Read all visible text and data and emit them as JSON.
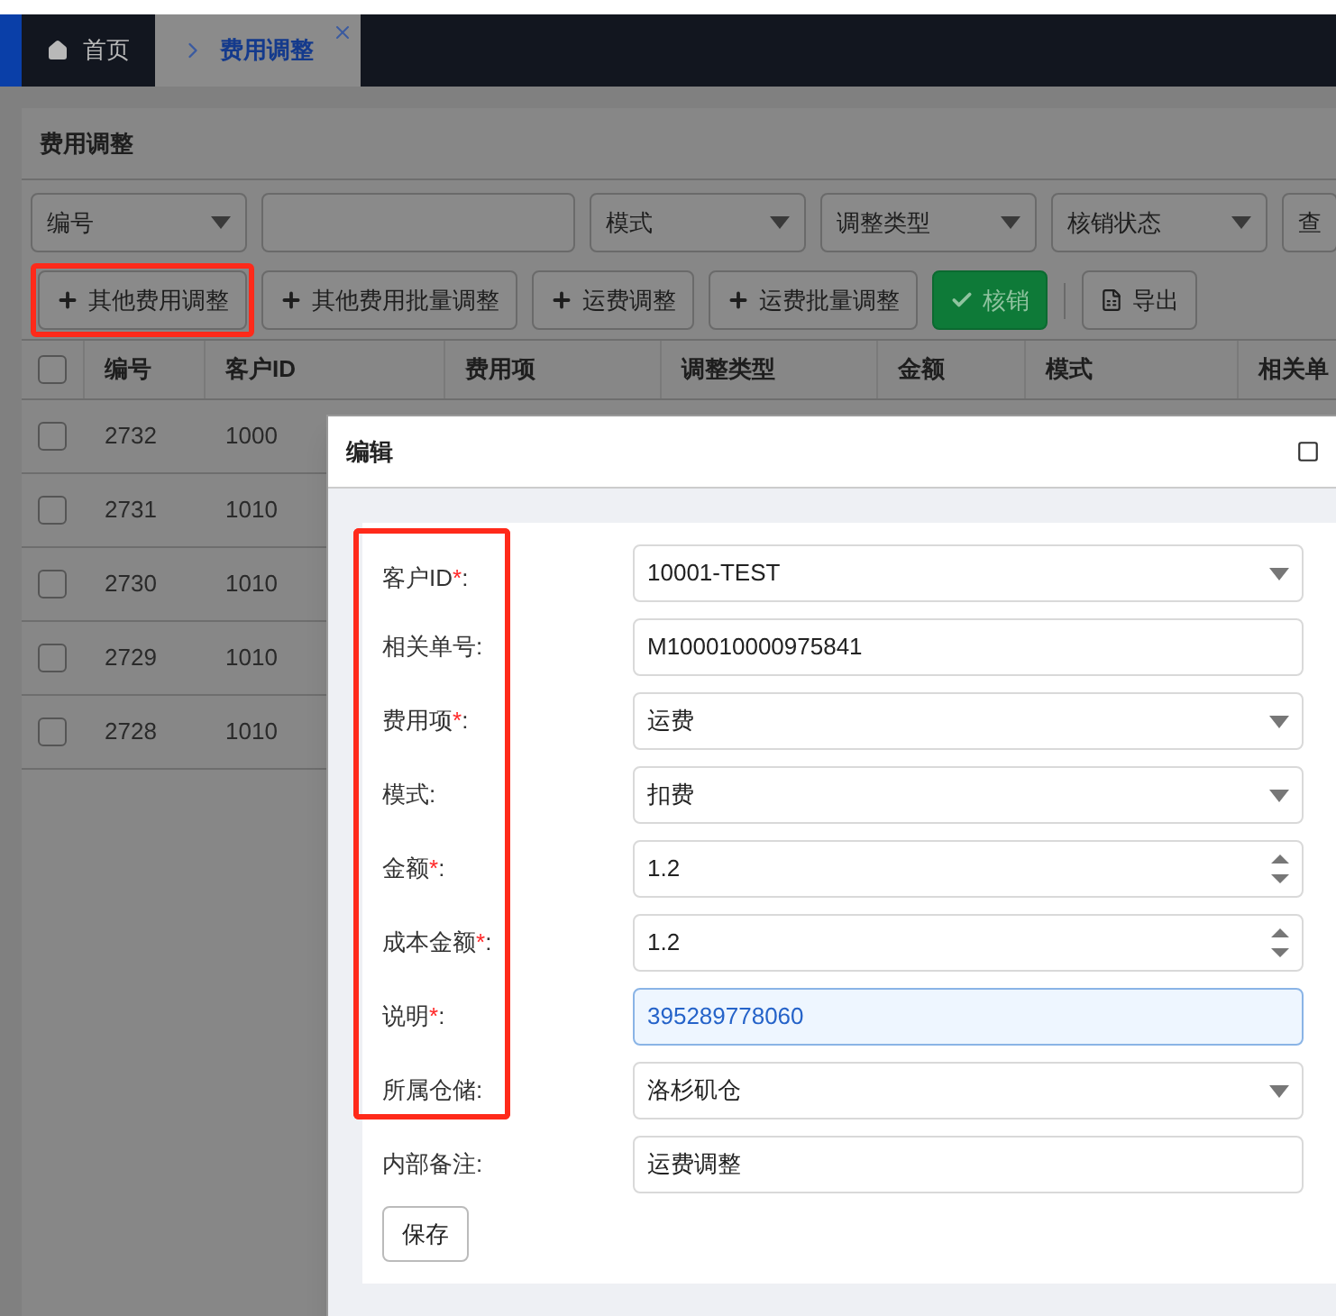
{
  "tabs": [
    {
      "kind": "home",
      "label": "首页",
      "selected": false
    },
    {
      "kind": "page",
      "label": "费用调整",
      "selected": true
    }
  ],
  "panel": {
    "title": "费用调整"
  },
  "filters": [
    {
      "kind": "select",
      "placeholder": "编号"
    },
    {
      "kind": "input"
    },
    {
      "kind": "select",
      "placeholder": "模式"
    },
    {
      "kind": "select",
      "placeholder": "调整类型"
    },
    {
      "kind": "select",
      "placeholder": "核销状态"
    },
    {
      "kind": "button",
      "label": "查"
    }
  ],
  "toolbar": [
    {
      "kind": "add",
      "label": "其他费用调整",
      "highlighted": true
    },
    {
      "kind": "add",
      "label": "其他费用批量调整",
      "highlighted": false
    },
    {
      "kind": "add",
      "label": "运费调整",
      "highlighted": false
    },
    {
      "kind": "add",
      "label": "运费批量调整",
      "highlighted": false
    },
    {
      "kind": "confirm",
      "label": "核销",
      "highlighted": false
    },
    {
      "kind": "separator"
    },
    {
      "kind": "export",
      "label": "导出",
      "highlighted": false
    }
  ],
  "table": {
    "header_checked": false,
    "columns": [
      "编号",
      "客户ID",
      "费用项",
      "调整类型",
      "金额",
      "模式",
      "相关单"
    ],
    "rows": [
      {
        "checked": false,
        "cells": [
          "2732",
          "1000"
        ]
      },
      {
        "checked": false,
        "cells": [
          "2731",
          "1010"
        ]
      },
      {
        "checked": false,
        "cells": [
          "2730",
          "1010"
        ]
      },
      {
        "checked": false,
        "cells": [
          "2729",
          "1010"
        ]
      },
      {
        "checked": false,
        "cells": [
          "2728",
          "1010"
        ]
      }
    ]
  },
  "modal": {
    "title": "编辑",
    "fields": [
      {
        "label": "客户ID",
        "asterisk": "*",
        "colon": ":",
        "kind": "select",
        "value": "10001-TEST",
        "focused": false,
        "highlighted": true
      },
      {
        "label": "相关单号",
        "colon": ":",
        "kind": "text",
        "value": "M100010000975841",
        "focused": false,
        "highlighted": true
      },
      {
        "label": "费用项",
        "asterisk": "*",
        "colon": ":",
        "kind": "select",
        "value": "运费",
        "focused": false,
        "highlighted": true
      },
      {
        "label": "模式",
        "colon": ":",
        "kind": "select",
        "value": "扣费",
        "focused": false,
        "highlighted": true
      },
      {
        "label": "金额",
        "asterisk": "*",
        "colon": ":",
        "kind": "number",
        "value": "1.2",
        "focused": false,
        "highlighted": true
      },
      {
        "label": "成本金额",
        "asterisk": "*",
        "colon": ":",
        "kind": "number",
        "value": "1.2",
        "focused": false,
        "highlighted": true
      },
      {
        "label": "说明",
        "asterisk": "*",
        "colon": ":",
        "kind": "text",
        "value": "395289778060",
        "focused": true,
        "highlighted": true
      },
      {
        "label": "所属仓储",
        "colon": ":",
        "kind": "select",
        "value": "洛杉矶仓",
        "focused": false,
        "highlighted": true
      },
      {
        "label": "内部备注",
        "colon": ":",
        "kind": "text",
        "value": "运费调整",
        "focused": false,
        "highlighted": false
      }
    ],
    "save_button": "保存"
  }
}
